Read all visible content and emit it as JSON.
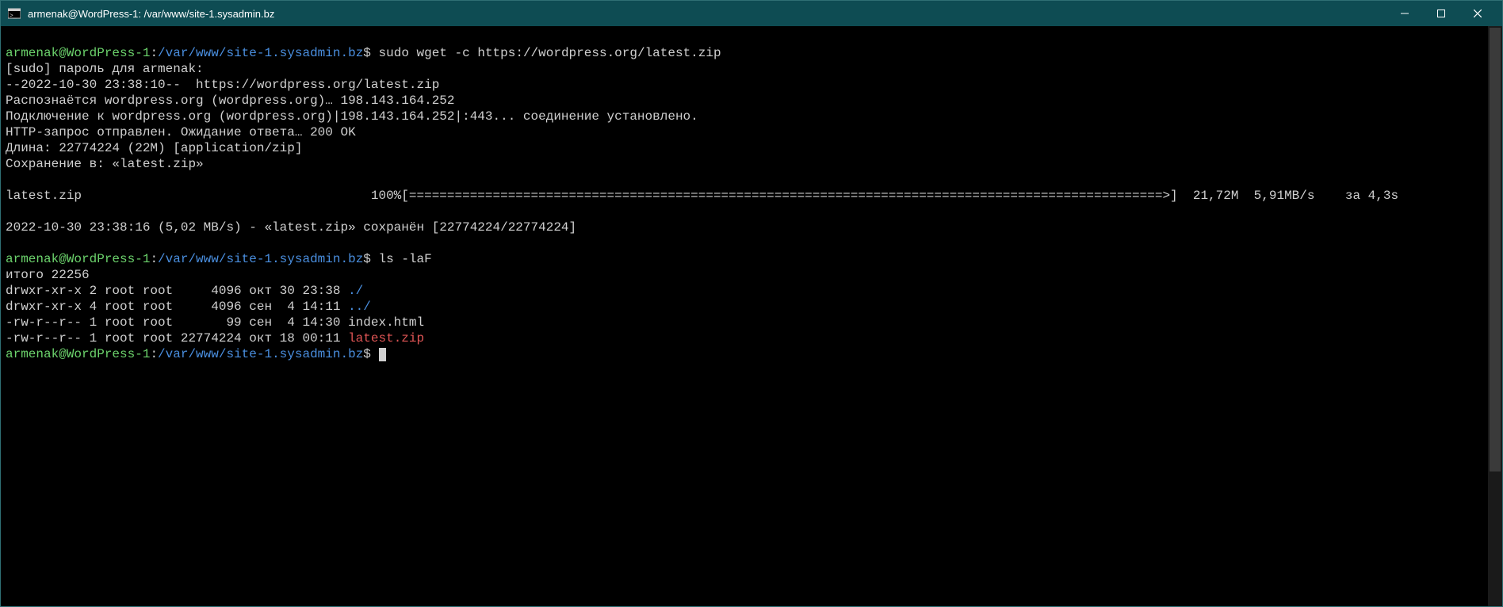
{
  "titlebar": {
    "title": "armenak@WordPress-1: /var/www/site-1.sysadmin.bz"
  },
  "prompt": {
    "user_host": "armenak@WordPress-1",
    "sep": ":",
    "cwd": "/var/www/site-1.sysadmin.bz",
    "sym": "$"
  },
  "cmd1": "sudo wget -c https://wordpress.org/latest.zip",
  "wget": {
    "sudo_pw": "[sudo] пароль для armenak:",
    "l1": "--2022-10-30 23:38:10--  https://wordpress.org/latest.zip",
    "l2": "Распознаётся wordpress.org (wordpress.org)… 198.143.164.252",
    "l3": "Подключение к wordpress.org (wordpress.org)|198.143.164.252|:443... соединение установлено.",
    "l4": "HTTP-запрос отправлен. Ожидание ответа… 200 OK",
    "l5": "Длина: 22774224 (22M) [application/zip]",
    "l6": "Сохранение в: «latest.zip»",
    "pb_name": "latest.zip",
    "pb_pct": "100%",
    "pb_bar": "[===================================================================================================>]",
    "pb_size": "21,72M",
    "pb_speed": "5,91MB/s",
    "pb_eta": "за 4,3s",
    "done": "2022-10-30 23:38:16 (5,02 MB/s) - «latest.zip» сохранён [22774224/22774224]"
  },
  "cmd2": "ls -laF",
  "ls": {
    "total": "итого 22256",
    "r0": "drwxr-xr-x 2 root root     4096 окт 30 23:38 ",
    "r0dir": "./",
    "r1": "drwxr-xr-x 4 root root     4096 сен  4 14:11 ",
    "r1dir": "../",
    "r2": "-rw-r--r-- 1 root root       99 сен  4 14:30 index.html",
    "r3": "-rw-r--r-- 1 root root 22774224 окт 18 00:11 ",
    "r3zip": "latest.zip"
  }
}
